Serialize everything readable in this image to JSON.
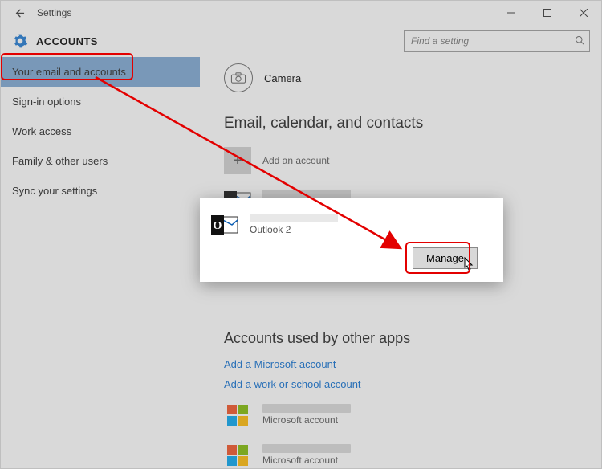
{
  "titlebar": {
    "title": "Settings"
  },
  "header": {
    "title": "ACCOUNTS",
    "search_placeholder": "Find a setting"
  },
  "sidebar": {
    "items": [
      {
        "label": "Your email and accounts",
        "selected": true
      },
      {
        "label": "Sign-in options"
      },
      {
        "label": "Work access"
      },
      {
        "label": "Family & other users"
      },
      {
        "label": "Sync your settings"
      }
    ]
  },
  "camera": {
    "label": "Camera"
  },
  "section_email": {
    "title": "Email, calendar, and contacts"
  },
  "add_account": {
    "label": "Add an account"
  },
  "accounts": [
    {
      "provider": "Outlook"
    },
    {
      "provider": "Outlook 2"
    }
  ],
  "manage_button": {
    "label": "Manage"
  },
  "section_used_by": {
    "title": "Accounts used by other apps"
  },
  "links": {
    "add_ms": "Add a Microsoft account",
    "add_work": "Add a work or school account"
  },
  "ms_accounts": [
    {
      "provider": "Microsoft account"
    },
    {
      "provider": "Microsoft account"
    }
  ]
}
